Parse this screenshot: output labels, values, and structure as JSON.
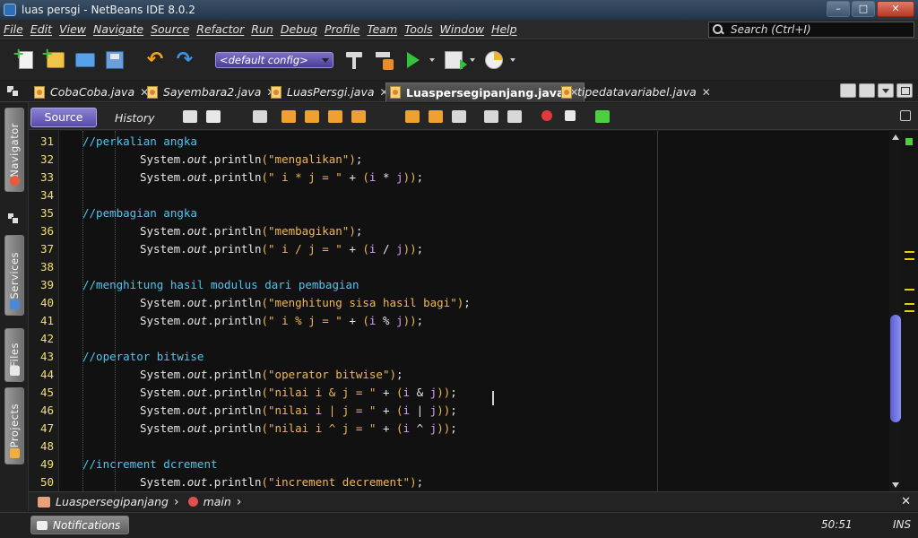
{
  "window": {
    "title": "luas persgi - NetBeans IDE 8.0.2",
    "controls": [
      "–",
      "□",
      "✕"
    ]
  },
  "menu": [
    "File",
    "Edit",
    "View",
    "Navigate",
    "Source",
    "Refactor",
    "Run",
    "Debug",
    "Profile",
    "Team",
    "Tools",
    "Window",
    "Help"
  ],
  "search": {
    "placeholder": "Search (Ctrl+I)"
  },
  "toolbar": {
    "config_select": "<default config>",
    "icons": [
      "new-file-icon",
      "new-project-icon",
      "open-project-icon",
      "save-all-icon",
      "undo-icon",
      "redo-icon",
      "build-icon",
      "clean-build-icon",
      "run-icon",
      "debug-icon",
      "profile-icon"
    ]
  },
  "tabs": [
    {
      "label": "CobaCoba.java",
      "active": false
    },
    {
      "label": "Sayembara2.java",
      "active": false
    },
    {
      "label": "LuasPersgi.java",
      "active": false
    },
    {
      "label": "Luaspersegipanjang.java",
      "active": true
    },
    {
      "label": "tipedatavariabel.java",
      "active": false
    }
  ],
  "sidebar": [
    "Navigator",
    "Services",
    "Files",
    "Projects"
  ],
  "editor_toolbar": {
    "source": "Source",
    "history": "History"
  },
  "code_lines": [
    {
      "n": "31",
      "comment": "//perkalian angka"
    },
    {
      "n": "32",
      "str": "\"mengalikan\""
    },
    {
      "n": "33",
      "str": "\" i * j = \"",
      "op": "*"
    },
    {
      "n": "34"
    },
    {
      "n": "35",
      "comment": "//pembagian angka"
    },
    {
      "n": "36",
      "str": "\"membagikan\""
    },
    {
      "n": "37",
      "str": "\" i / j = \"",
      "op": "/"
    },
    {
      "n": "38"
    },
    {
      "n": "39",
      "comment": "//menghitung hasil modulus dari pembagian"
    },
    {
      "n": "40",
      "str": "\"menghitung sisa hasil bagi\""
    },
    {
      "n": "41",
      "str": "\" i % j = \"",
      "op": "%"
    },
    {
      "n": "42"
    },
    {
      "n": "43",
      "comment": "//operator bitwise"
    },
    {
      "n": "44",
      "str": "\"operator bitwise\""
    },
    {
      "n": "45",
      "str": "\"nilai i & j = \"",
      "op": "&"
    },
    {
      "n": "46",
      "str": "\"nilai i | j = \"",
      "op": "|"
    },
    {
      "n": "47",
      "str": "\"nilai i ^ j = \"",
      "op": "^"
    },
    {
      "n": "48"
    },
    {
      "n": "49",
      "comment": "//increment dcrement"
    },
    {
      "n": "50",
      "str": "\"increment decrement\""
    }
  ],
  "code_tokens": {
    "system": "System.",
    "out": "out",
    "println": ".println",
    "i": "i",
    "j": "j",
    "plus": " + "
  },
  "breadcrumb": {
    "class": "Luaspersegipanjang",
    "method": "main"
  },
  "status": {
    "notifications": "Notifications",
    "position": "50:51",
    "mode": "INS"
  }
}
